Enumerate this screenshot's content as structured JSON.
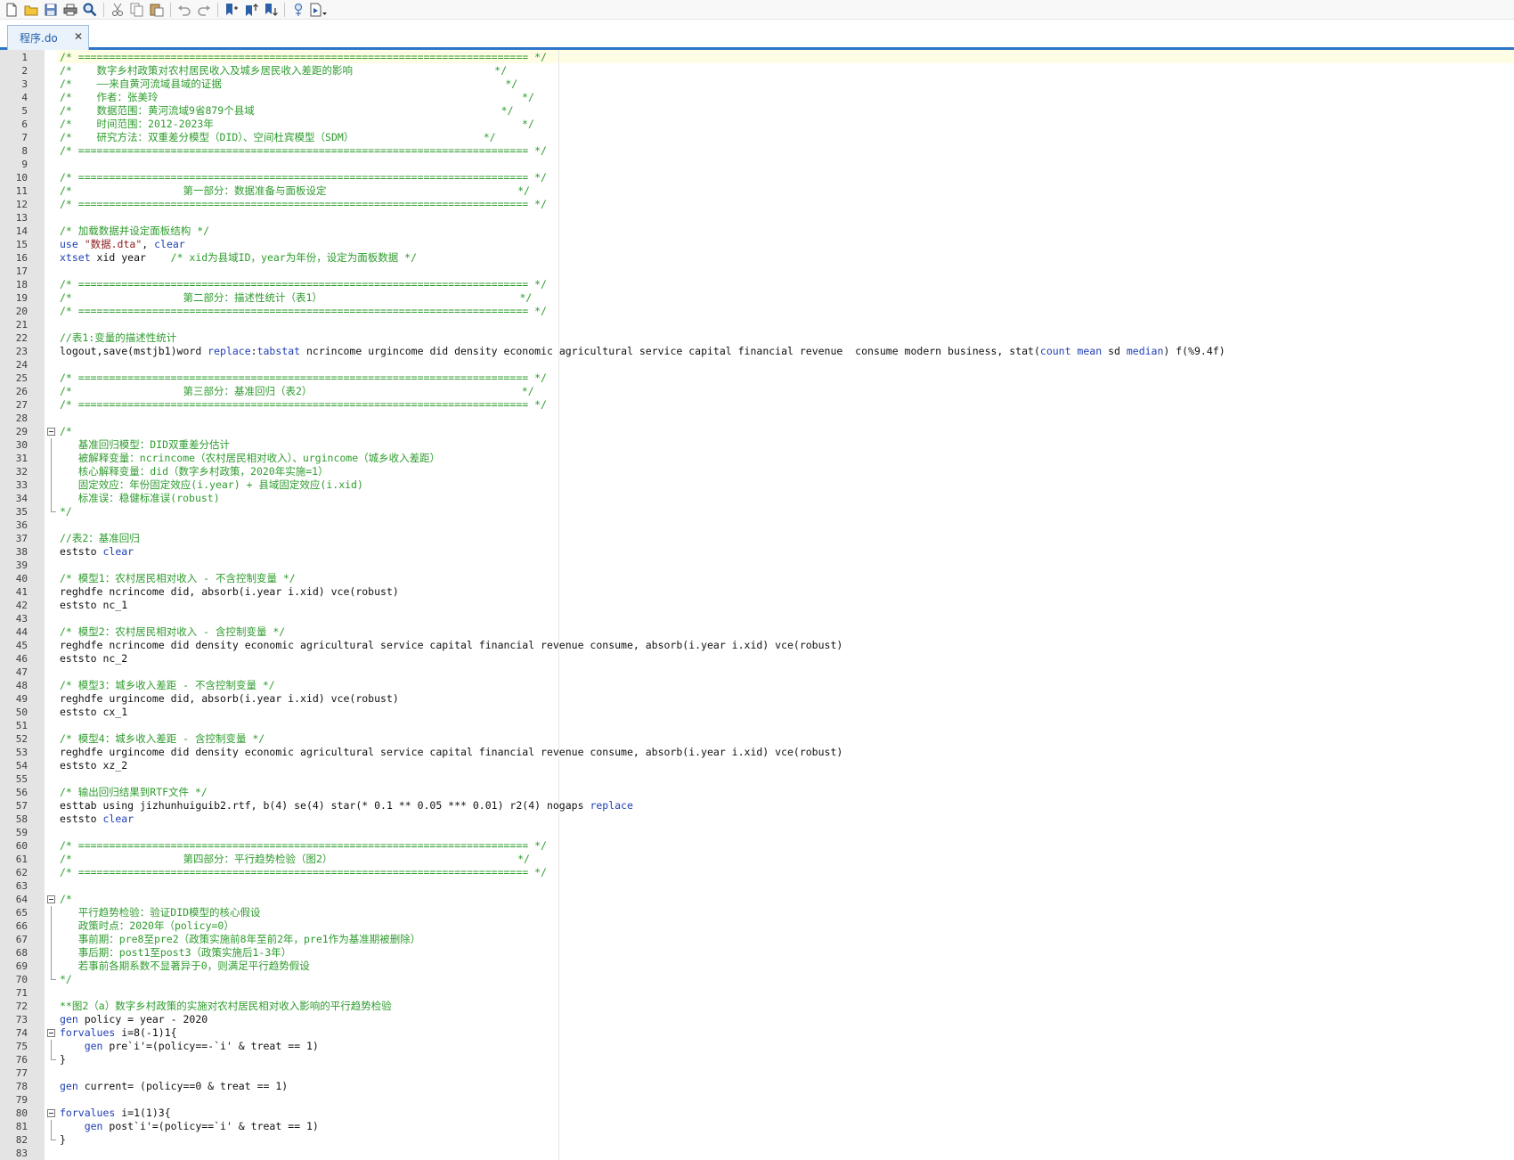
{
  "toolbar": {
    "buttons": [
      {
        "name": "new-file-icon"
      },
      {
        "name": "open-folder-icon"
      },
      {
        "name": "save-icon"
      },
      {
        "name": "print-icon"
      },
      {
        "name": "find-icon"
      },
      {
        "name": "cut-icon"
      },
      {
        "name": "copy-icon"
      },
      {
        "name": "paste-icon"
      },
      {
        "name": "undo-icon"
      },
      {
        "name": "redo-icon"
      },
      {
        "name": "bookmark-toggle-icon"
      },
      {
        "name": "bookmark-prev-icon"
      },
      {
        "name": "bookmark-next-icon"
      },
      {
        "name": "show-file-icon"
      },
      {
        "name": "execute-do-icon"
      }
    ]
  },
  "tab": {
    "label": "程序.do",
    "close": "✕"
  },
  "colors": {
    "comment": "#2e9c2e",
    "keyword": "#1f3fb3",
    "string": "#8b1a1a",
    "text": "#101010",
    "accent": "#2e75c7"
  },
  "lines": [
    {
      "n": "1",
      "fold": "",
      "tokens": [
        {
          "t": "c",
          "s": "/* ========================================================================= */"
        }
      ]
    },
    {
      "n": "2",
      "fold": "",
      "tokens": [
        {
          "t": "c",
          "s": "/*    数字乡村政策对农村居民收入及城乡居民收入差距的影响                       */"
        }
      ]
    },
    {
      "n": "3",
      "fold": "",
      "tokens": [
        {
          "t": "c",
          "s": "/*    ——来自黄河流域县域的证据                                              */"
        }
      ]
    },
    {
      "n": "4",
      "fold": "",
      "tokens": [
        {
          "t": "c",
          "s": "/*    作者：张美玲                                                           */"
        }
      ]
    },
    {
      "n": "5",
      "fold": "",
      "tokens": [
        {
          "t": "c",
          "s": "/*    数据范围：黄河流域9省879个县域                                        */"
        }
      ]
    },
    {
      "n": "6",
      "fold": "",
      "tokens": [
        {
          "t": "c",
          "s": "/*    时间范围：2012-2023年                                                  */"
        }
      ]
    },
    {
      "n": "7",
      "fold": "",
      "tokens": [
        {
          "t": "c",
          "s": "/*    研究方法：双重差分模型（DID）、空间杜宾模型（SDM）                     */"
        }
      ]
    },
    {
      "n": "8",
      "fold": "",
      "tokens": [
        {
          "t": "c",
          "s": "/* ========================================================================= */"
        }
      ]
    },
    {
      "n": "9",
      "fold": "",
      "tokens": []
    },
    {
      "n": "10",
      "fold": "",
      "tokens": [
        {
          "t": "c",
          "s": "/* ========================================================================= */"
        }
      ]
    },
    {
      "n": "11",
      "fold": "",
      "tokens": [
        {
          "t": "c",
          "s": "/*                  第一部分：数据准备与面板设定                               */"
        }
      ]
    },
    {
      "n": "12",
      "fold": "",
      "tokens": [
        {
          "t": "c",
          "s": "/* ========================================================================= */"
        }
      ]
    },
    {
      "n": "13",
      "fold": "",
      "tokens": []
    },
    {
      "n": "14",
      "fold": "",
      "tokens": [
        {
          "t": "c",
          "s": "/* 加载数据并设定面板结构 */"
        }
      ]
    },
    {
      "n": "15",
      "fold": "",
      "tokens": [
        {
          "t": "k",
          "s": "use "
        },
        {
          "t": "s",
          "s": "\"数据.dta\""
        },
        {
          "t": "x",
          "s": ", "
        },
        {
          "t": "k",
          "s": "clear"
        }
      ]
    },
    {
      "n": "16",
      "fold": "",
      "tokens": [
        {
          "t": "k",
          "s": "xtset"
        },
        {
          "t": "x",
          "s": " xid year    "
        },
        {
          "t": "c",
          "s": "/* xid为县域ID，year为年份，设定为面板数据 */"
        }
      ]
    },
    {
      "n": "17",
      "fold": "",
      "tokens": []
    },
    {
      "n": "18",
      "fold": "",
      "tokens": [
        {
          "t": "c",
          "s": "/* ========================================================================= */"
        }
      ]
    },
    {
      "n": "19",
      "fold": "",
      "tokens": [
        {
          "t": "c",
          "s": "/*                  第二部分：描述性统计（表1）                                */"
        }
      ]
    },
    {
      "n": "20",
      "fold": "",
      "tokens": [
        {
          "t": "c",
          "s": "/* ========================================================================= */"
        }
      ]
    },
    {
      "n": "21",
      "fold": "",
      "tokens": []
    },
    {
      "n": "22",
      "fold": "",
      "tokens": [
        {
          "t": "c",
          "s": "//表1:变量的描述性统计"
        }
      ]
    },
    {
      "n": "23",
      "fold": "",
      "tokens": [
        {
          "t": "x",
          "s": "logout,save(mstjb1)word "
        },
        {
          "t": "k",
          "s": "replace"
        },
        {
          "t": "x",
          "s": ":"
        },
        {
          "t": "k",
          "s": "tabstat"
        },
        {
          "t": "x",
          "s": " ncrincome urgincome did density economic agricultural service capital financial revenue  consume modern business, stat("
        },
        {
          "t": "k",
          "s": "count mean"
        },
        {
          "t": "x",
          "s": " sd "
        },
        {
          "t": "k",
          "s": "median"
        },
        {
          "t": "x",
          "s": ") f(%9.4f)"
        }
      ]
    },
    {
      "n": "24",
      "fold": "",
      "tokens": []
    },
    {
      "n": "25",
      "fold": "",
      "tokens": [
        {
          "t": "c",
          "s": "/* ========================================================================= */"
        }
      ]
    },
    {
      "n": "26",
      "fold": "",
      "tokens": [
        {
          "t": "c",
          "s": "/*                  第三部分：基准回归（表2）                                  */"
        }
      ]
    },
    {
      "n": "27",
      "fold": "",
      "tokens": [
        {
          "t": "c",
          "s": "/* ========================================================================= */"
        }
      ]
    },
    {
      "n": "28",
      "fold": "",
      "tokens": []
    },
    {
      "n": "29",
      "fold": "open",
      "tokens": [
        {
          "t": "c",
          "s": "/*"
        }
      ]
    },
    {
      "n": "30",
      "fold": "mid",
      "tokens": [
        {
          "t": "c",
          "s": "   基准回归模型：DID双重差分估计"
        }
      ]
    },
    {
      "n": "31",
      "fold": "mid",
      "tokens": [
        {
          "t": "c",
          "s": "   被解释变量：ncrincome（农村居民相对收入）、urgincome（城乡收入差距）"
        }
      ]
    },
    {
      "n": "32",
      "fold": "mid",
      "tokens": [
        {
          "t": "c",
          "s": "   核心解释变量：did（数字乡村政策，2020年实施=1）"
        }
      ]
    },
    {
      "n": "33",
      "fold": "mid",
      "tokens": [
        {
          "t": "c",
          "s": "   固定效应：年份固定效应(i.year) + 县域固定效应(i.xid)"
        }
      ]
    },
    {
      "n": "34",
      "fold": "mid",
      "tokens": [
        {
          "t": "c",
          "s": "   标准误：稳健标准误(robust)"
        }
      ]
    },
    {
      "n": "35",
      "fold": "end",
      "tokens": [
        {
          "t": "c",
          "s": "*/"
        }
      ]
    },
    {
      "n": "36",
      "fold": "",
      "tokens": []
    },
    {
      "n": "37",
      "fold": "",
      "tokens": [
        {
          "t": "c",
          "s": "//表2：基准回归"
        }
      ]
    },
    {
      "n": "38",
      "fold": "",
      "tokens": [
        {
          "t": "x",
          "s": "eststo "
        },
        {
          "t": "k",
          "s": "clear"
        }
      ]
    },
    {
      "n": "39",
      "fold": "",
      "tokens": []
    },
    {
      "n": "40",
      "fold": "",
      "tokens": [
        {
          "t": "c",
          "s": "/* 模型1：农村居民相对收入 - 不含控制变量 */"
        }
      ]
    },
    {
      "n": "41",
      "fold": "",
      "tokens": [
        {
          "t": "x",
          "s": "reghdfe ncrincome did, absorb(i.year i.xid) vce(robust)"
        }
      ]
    },
    {
      "n": "42",
      "fold": "",
      "tokens": [
        {
          "t": "x",
          "s": "eststo nc_1"
        }
      ]
    },
    {
      "n": "43",
      "fold": "",
      "tokens": []
    },
    {
      "n": "44",
      "fold": "",
      "tokens": [
        {
          "t": "c",
          "s": "/* 模型2：农村居民相对收入 - 含控制变量 */"
        }
      ]
    },
    {
      "n": "45",
      "fold": "",
      "tokens": [
        {
          "t": "x",
          "s": "reghdfe ncrincome did density economic agricultural service capital financial revenue consume, absorb(i.year i.xid) vce(robust)"
        }
      ]
    },
    {
      "n": "46",
      "fold": "",
      "tokens": [
        {
          "t": "x",
          "s": "eststo nc_2"
        }
      ]
    },
    {
      "n": "47",
      "fold": "",
      "tokens": []
    },
    {
      "n": "48",
      "fold": "",
      "tokens": [
        {
          "t": "c",
          "s": "/* 模型3：城乡收入差距 - 不含控制变量 */"
        }
      ]
    },
    {
      "n": "49",
      "fold": "",
      "tokens": [
        {
          "t": "x",
          "s": "reghdfe urgincome did, absorb(i.year i.xid) vce(robust)"
        }
      ]
    },
    {
      "n": "50",
      "fold": "",
      "tokens": [
        {
          "t": "x",
          "s": "eststo cx_1"
        }
      ]
    },
    {
      "n": "51",
      "fold": "",
      "tokens": []
    },
    {
      "n": "52",
      "fold": "",
      "tokens": [
        {
          "t": "c",
          "s": "/* 模型4：城乡收入差距 - 含控制变量 */"
        }
      ]
    },
    {
      "n": "53",
      "fold": "",
      "tokens": [
        {
          "t": "x",
          "s": "reghdfe urgincome did density economic agricultural service capital financial revenue consume, absorb(i.year i.xid) vce(robust)"
        }
      ]
    },
    {
      "n": "54",
      "fold": "",
      "tokens": [
        {
          "t": "x",
          "s": "eststo xz_2"
        }
      ]
    },
    {
      "n": "55",
      "fold": "",
      "tokens": []
    },
    {
      "n": "56",
      "fold": "",
      "tokens": [
        {
          "t": "c",
          "s": "/* 输出回归结果到RTF文件 */"
        }
      ]
    },
    {
      "n": "57",
      "fold": "",
      "tokens": [
        {
          "t": "x",
          "s": "esttab using jizhunhuiguib2.rtf, b(4) se(4) star(* 0.1 ** 0.05 *** 0.01) r2(4) nogaps "
        },
        {
          "t": "k",
          "s": "replace"
        }
      ]
    },
    {
      "n": "58",
      "fold": "",
      "tokens": [
        {
          "t": "x",
          "s": "eststo "
        },
        {
          "t": "k",
          "s": "clear"
        }
      ]
    },
    {
      "n": "59",
      "fold": "",
      "tokens": []
    },
    {
      "n": "60",
      "fold": "",
      "tokens": [
        {
          "t": "c",
          "s": "/* ========================================================================= */"
        }
      ]
    },
    {
      "n": "61",
      "fold": "",
      "tokens": [
        {
          "t": "c",
          "s": "/*                  第四部分：平行趋势检验（图2）                              */"
        }
      ]
    },
    {
      "n": "62",
      "fold": "",
      "tokens": [
        {
          "t": "c",
          "s": "/* ========================================================================= */"
        }
      ]
    },
    {
      "n": "63",
      "fold": "",
      "tokens": []
    },
    {
      "n": "64",
      "fold": "open",
      "tokens": [
        {
          "t": "c",
          "s": "/*"
        }
      ]
    },
    {
      "n": "65",
      "fold": "mid",
      "tokens": [
        {
          "t": "c",
          "s": "   平行趋势检验：验证DID模型的核心假设"
        }
      ]
    },
    {
      "n": "66",
      "fold": "mid",
      "tokens": [
        {
          "t": "c",
          "s": "   政策时点：2020年（policy=0）"
        }
      ]
    },
    {
      "n": "67",
      "fold": "mid",
      "tokens": [
        {
          "t": "c",
          "s": "   事前期：pre8至pre2（政策实施前8年至前2年，pre1作为基准期被删除）"
        }
      ]
    },
    {
      "n": "68",
      "fold": "mid",
      "tokens": [
        {
          "t": "c",
          "s": "   事后期：post1至post3（政策实施后1-3年）"
        }
      ]
    },
    {
      "n": "69",
      "fold": "mid",
      "tokens": [
        {
          "t": "c",
          "s": "   若事前各期系数不显著异于0，则满足平行趋势假设"
        }
      ]
    },
    {
      "n": "70",
      "fold": "end",
      "tokens": [
        {
          "t": "c",
          "s": "*/"
        }
      ]
    },
    {
      "n": "71",
      "fold": "",
      "tokens": []
    },
    {
      "n": "72",
      "fold": "",
      "tokens": [
        {
          "t": "c",
          "s": "**图2（a）数字乡村政策的实施对农村居民相对收入影响的平行趋势检验"
        }
      ]
    },
    {
      "n": "73",
      "fold": "",
      "tokens": [
        {
          "t": "k",
          "s": "gen"
        },
        {
          "t": "x",
          "s": " policy = year - 2020"
        }
      ]
    },
    {
      "n": "74",
      "fold": "open",
      "tokens": [
        {
          "t": "k",
          "s": "forvalues"
        },
        {
          "t": "x",
          "s": " i=8(-1)1{"
        }
      ]
    },
    {
      "n": "75",
      "fold": "mid",
      "tokens": [
        {
          "t": "x",
          "s": "    "
        },
        {
          "t": "k",
          "s": "gen"
        },
        {
          "t": "x",
          "s": " pre`i'=(policy==-`i' & treat == 1)"
        }
      ]
    },
    {
      "n": "76",
      "fold": "end",
      "tokens": [
        {
          "t": "x",
          "s": "}"
        }
      ]
    },
    {
      "n": "77",
      "fold": "",
      "tokens": []
    },
    {
      "n": "78",
      "fold": "",
      "tokens": [
        {
          "t": "k",
          "s": "gen"
        },
        {
          "t": "x",
          "s": " current= (policy==0 & treat == 1)"
        }
      ]
    },
    {
      "n": "79",
      "fold": "",
      "tokens": []
    },
    {
      "n": "80",
      "fold": "open",
      "tokens": [
        {
          "t": "k",
          "s": "forvalues"
        },
        {
          "t": "x",
          "s": " i=1(1)3{"
        }
      ]
    },
    {
      "n": "81",
      "fold": "mid",
      "tokens": [
        {
          "t": "x",
          "s": "    "
        },
        {
          "t": "k",
          "s": "gen"
        },
        {
          "t": "x",
          "s": " post`i'=(policy==`i' & treat == 1)"
        }
      ]
    },
    {
      "n": "82",
      "fold": "end",
      "tokens": [
        {
          "t": "x",
          "s": "}"
        }
      ]
    },
    {
      "n": "83",
      "fold": "",
      "tokens": []
    }
  ]
}
